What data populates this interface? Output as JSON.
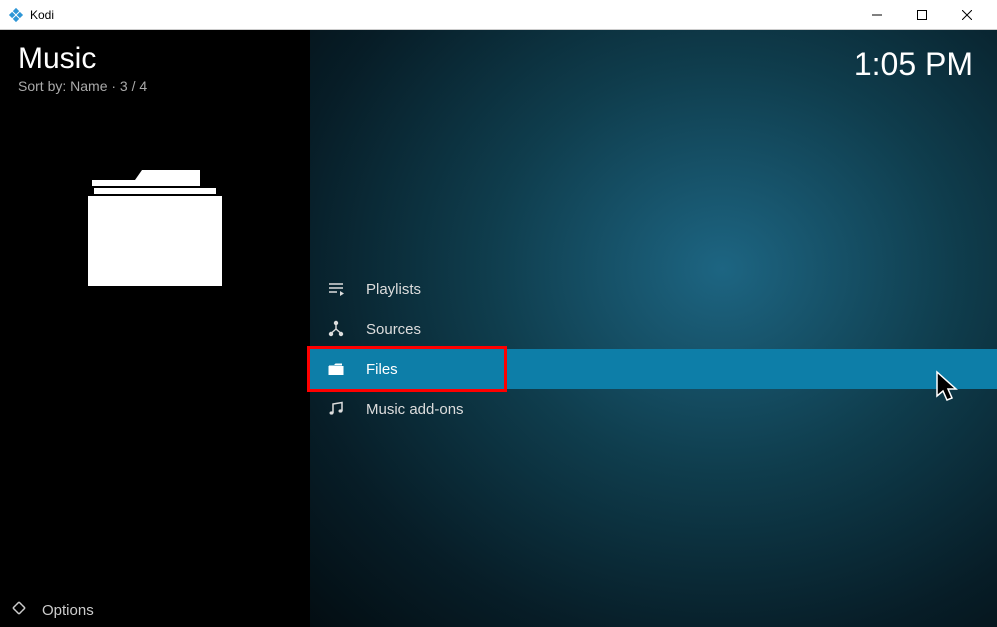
{
  "window": {
    "title": "Kodi"
  },
  "sidebar": {
    "title": "Music",
    "sort": "Sort by: Name  ·  3 / 4",
    "options_label": "Options"
  },
  "clock": "1:05 PM",
  "menu": {
    "items": [
      {
        "label": "Playlists",
        "icon": "playlist"
      },
      {
        "label": "Sources",
        "icon": "sources"
      },
      {
        "label": "Files",
        "icon": "folder",
        "selected": true,
        "highlighted": true
      },
      {
        "label": "Music add-ons",
        "icon": "music"
      }
    ]
  }
}
